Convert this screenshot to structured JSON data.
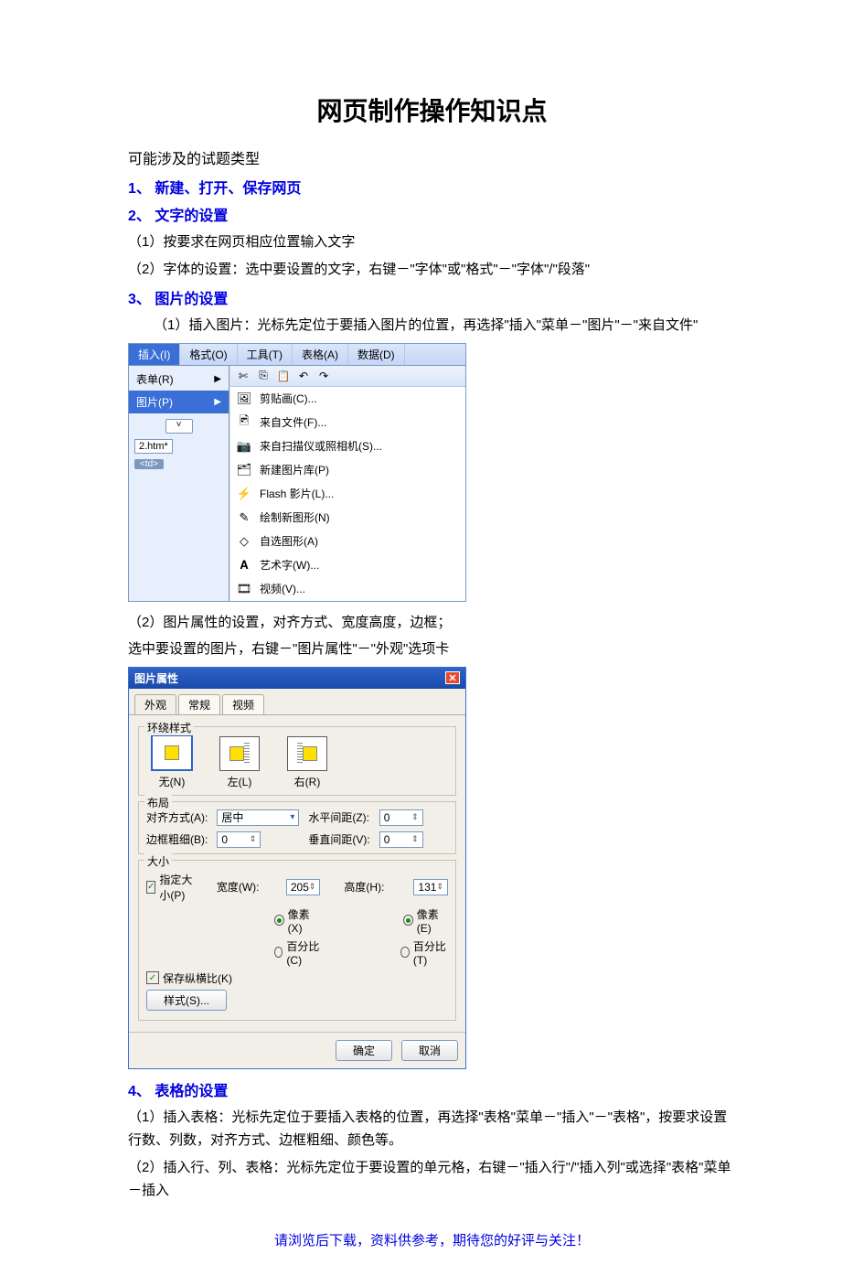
{
  "title": "网页制作操作知识点",
  "subtitle": "可能涉及的试题类型",
  "sections": {
    "s1": {
      "head": "1、 新建、打开、保存网页"
    },
    "s2": {
      "head": "2、 文字的设置",
      "p1": "（1）按要求在网页相应位置输入文字",
      "p2": "（2）字体的设置：选中要设置的文字，右键－\"字体\"或\"格式\"－\"字体\"/\"段落\""
    },
    "s3": {
      "head": "3、 图片的设置",
      "p1": "（1）插入图片：光标先定位于要插入图片的位置，再选择\"插入\"菜单－\"图片\"－\"来自文件\"",
      "p2": "（2）图片属性的设置，对齐方式、宽度高度，边框；",
      "p3": "选中要设置的图片，右键－\"图片属性\"－\"外观\"选项卡"
    },
    "s4": {
      "head": "4、 表格的设置",
      "p1": "（1）插入表格：光标先定位于要插入表格的位置，再选择\"表格\"菜单－\"插入\"－\"表格\"，按要求设置行数、列数，对齐方式、边框粗细、颜色等。",
      "p2": "（2）插入行、列、表格：光标先定位于要设置的单元格，右键－\"插入行\"/\"插入列\"或选择\"表格\"菜单－插入"
    }
  },
  "menu_screenshot": {
    "menubar": [
      "插入(I)",
      "格式(O)",
      "工具(T)",
      "表格(A)",
      "数据(D)"
    ],
    "left_items": {
      "form": "表单(R)",
      "picture": "图片(P)"
    },
    "htm_label": "2.htm*",
    "tag_label": "<td>",
    "submenu": {
      "clipart": "剪贴画(C)...",
      "fromfile": "来自文件(F)...",
      "scanner": "来自扫描仪或照相机(S)...",
      "gallery": "新建图片库(P)",
      "flash": "Flash 影片(L)...",
      "drawnew": "绘制新图形(N)",
      "autoshape": "自选图形(A)",
      "wordart": "艺术字(W)...",
      "video": "视频(V)..."
    },
    "toolbar_icons": {
      "cut": "✄",
      "copy": "⎘",
      "paste": "📋",
      "undo": "↶",
      "redo": "↷"
    }
  },
  "dialog": {
    "title": "图片属性",
    "tabs": {
      "appearance": "外观",
      "general": "常规",
      "video": "视频"
    },
    "wrap_group": {
      "title": "环绕样式",
      "none": "无(N)",
      "left": "左(L)",
      "right": "右(R)"
    },
    "layout_group": {
      "title": "布局",
      "align_label": "对齐方式(A):",
      "align_value": "居中",
      "border_label": "边框粗细(B):",
      "border_value": "0",
      "hspace_label": "水平间距(Z):",
      "hspace_value": "0",
      "vspace_label": "垂直间距(V):",
      "vspace_value": "0"
    },
    "size_group": {
      "title": "大小",
      "specify": "指定大小(P)",
      "width_label": "宽度(W):",
      "width_value": "205",
      "height_label": "高度(H):",
      "height_value": "131",
      "px_w": "像素(X)",
      "pct_w": "百分比(C)",
      "px_h": "像素(E)",
      "pct_h": "百分比(T)",
      "keep_ratio": "保存纵横比(K)",
      "style_btn": "样式(S)..."
    },
    "buttons": {
      "ok": "确定",
      "cancel": "取消"
    }
  },
  "footer": "请浏览后下载，资料供参考，期待您的好评与关注！"
}
